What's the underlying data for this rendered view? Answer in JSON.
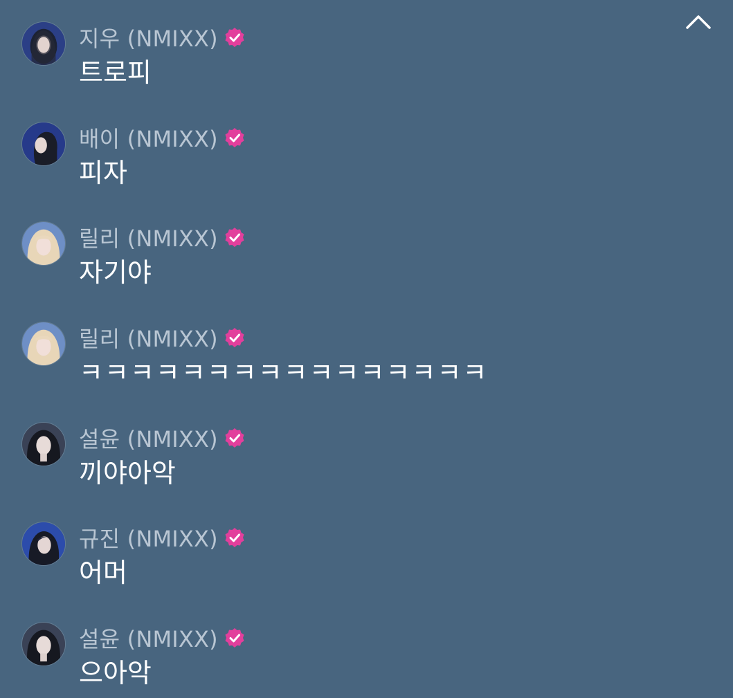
{
  "controls": {
    "collapse_icon": "chevron-up-icon"
  },
  "colors": {
    "background": "#48657f",
    "name_text": "#b9c6d3",
    "message_text": "#ffffff",
    "verified_badge": "#e23f9c"
  },
  "messages": [
    {
      "name": "지우 (NMIXX)",
      "text": "트로피",
      "verified": true
    },
    {
      "name": "배이 (NMIXX)",
      "text": "피자",
      "verified": true
    },
    {
      "name": "릴리 (NMIXX)",
      "text": "자기야",
      "verified": true
    },
    {
      "name": "릴리 (NMIXX)",
      "text": "ㅋㅋㅋㅋㅋㅋㅋㅋㅋㅋㅋㅋㅋㅋㅋㅋ",
      "verified": true
    },
    {
      "name": "설윤 (NMIXX)",
      "text": "끼야아악",
      "verified": true
    },
    {
      "name": "규진 (NMIXX)",
      "text": "어머",
      "verified": true
    },
    {
      "name": "설윤 (NMIXX)",
      "text": "으아악",
      "verified": true
    }
  ]
}
